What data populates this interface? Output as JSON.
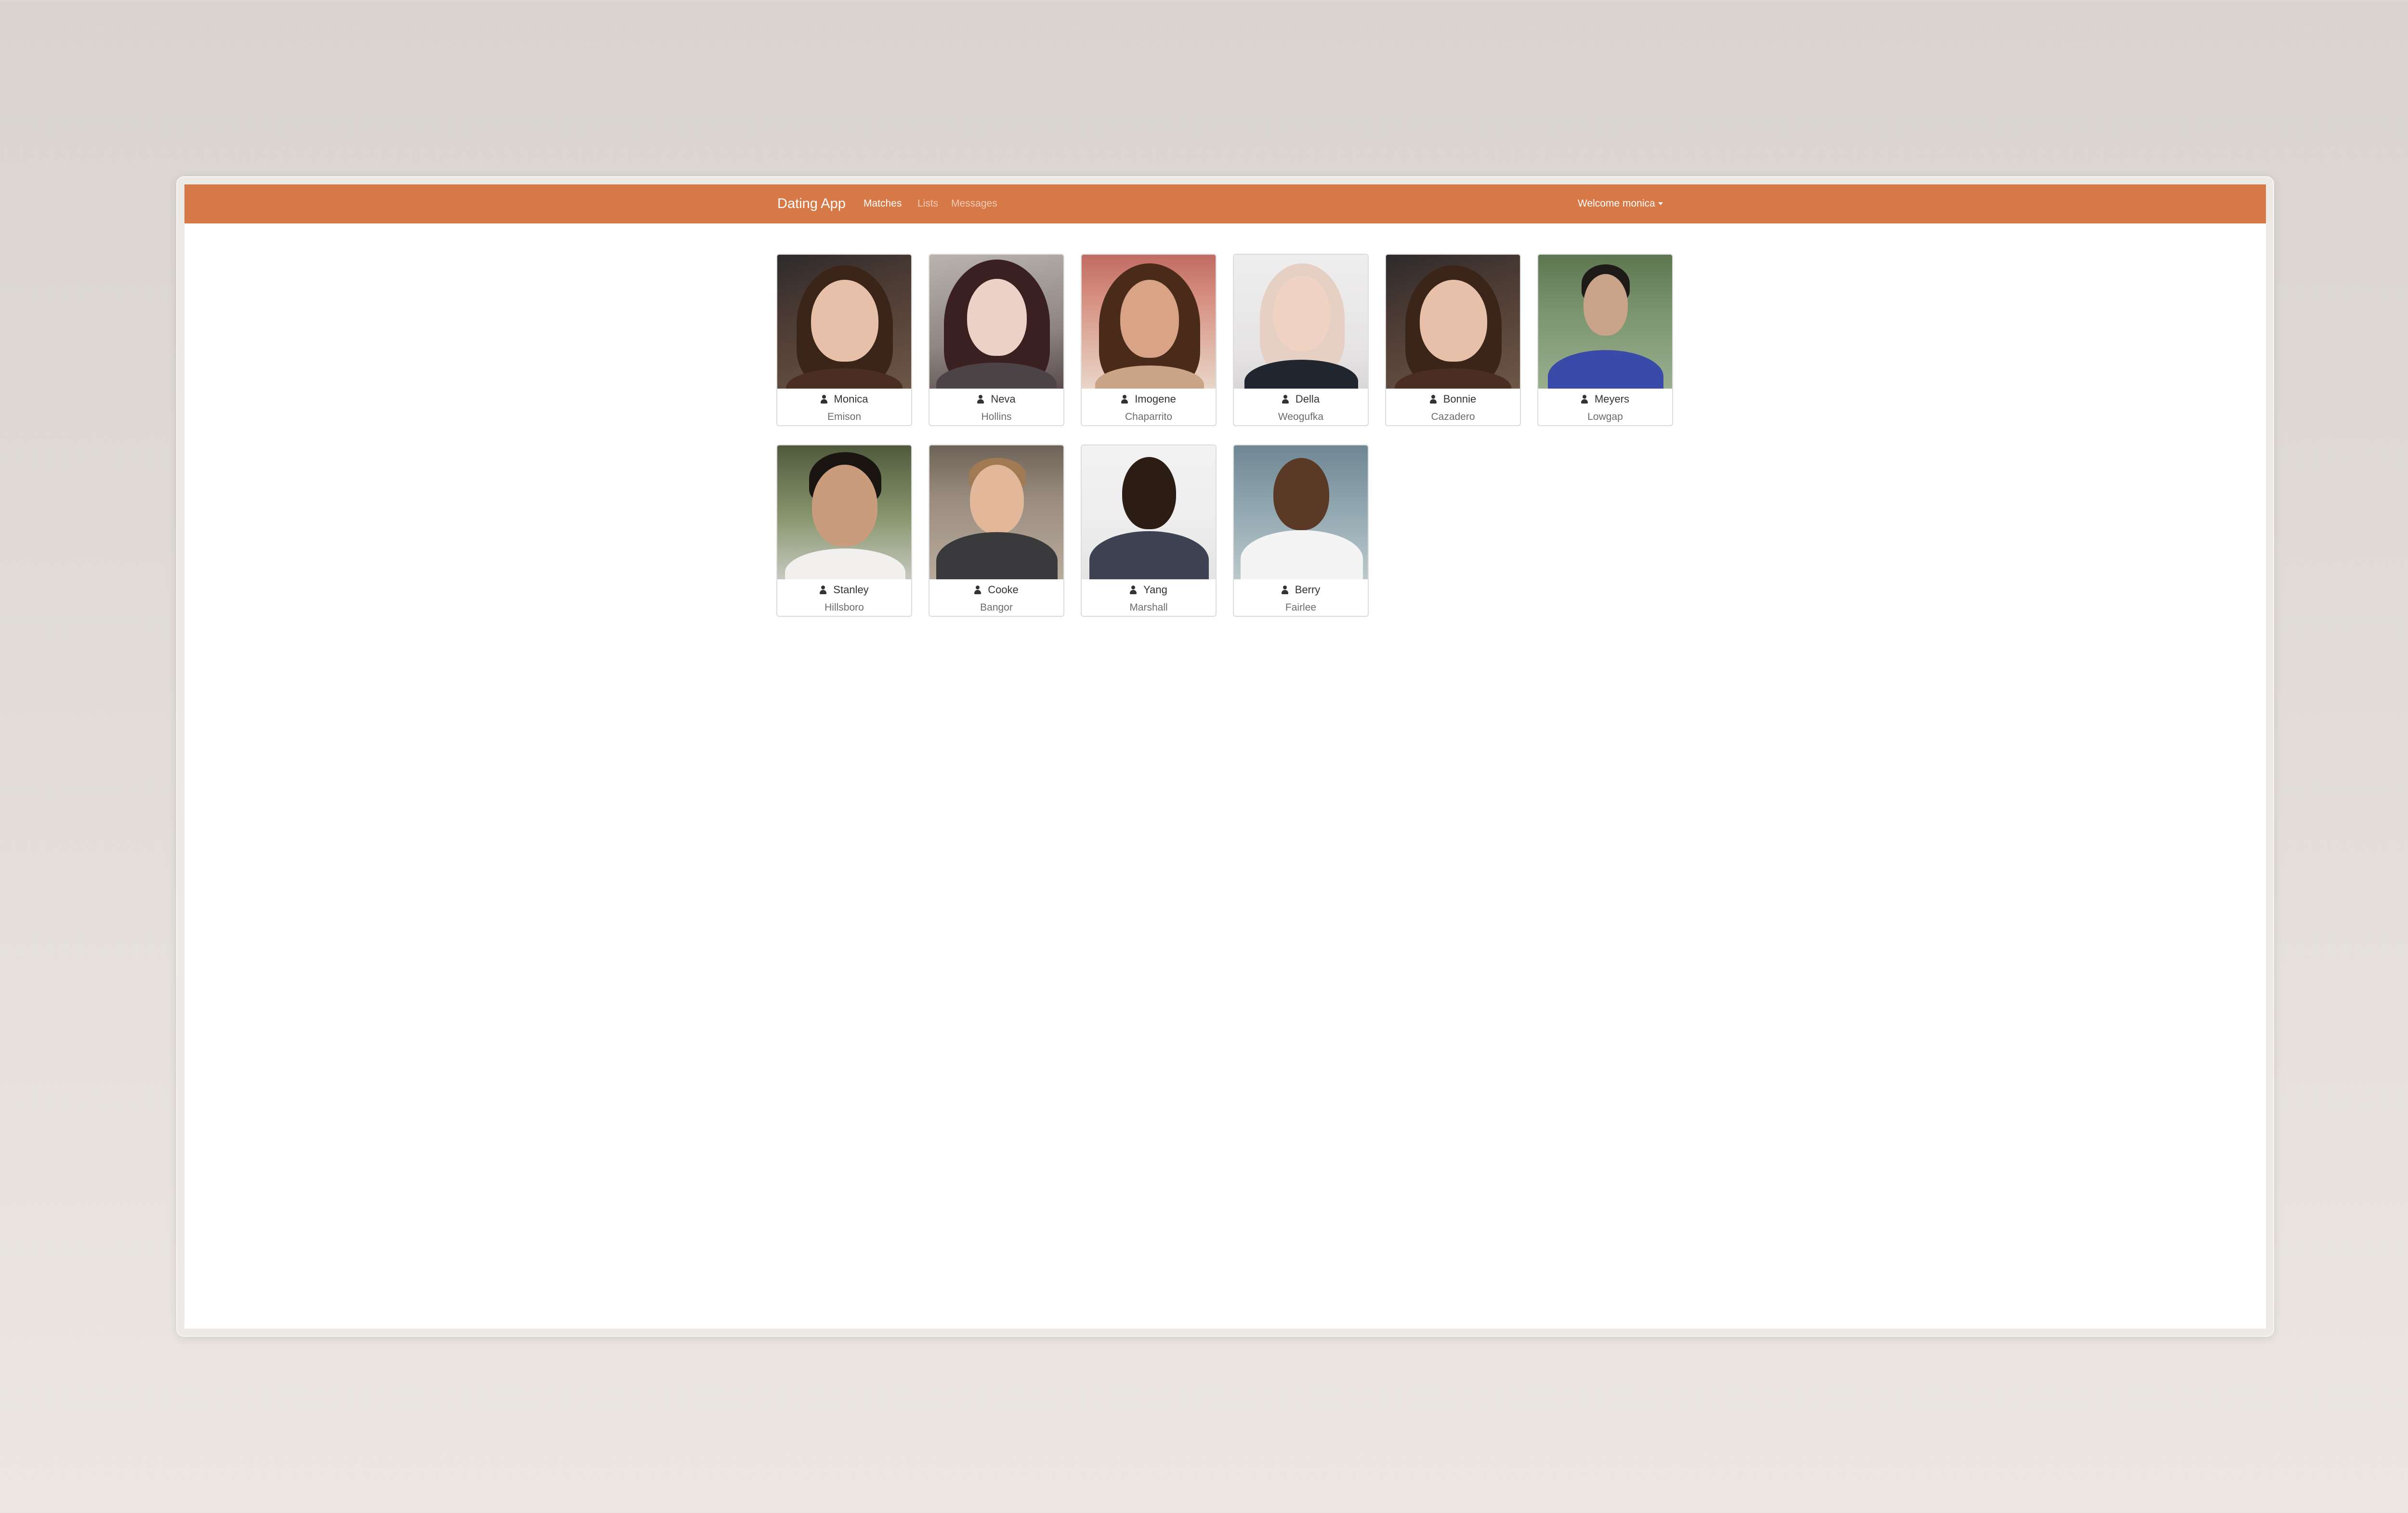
{
  "app": {
    "brand": "Dating App",
    "nav": [
      {
        "label": "Matches",
        "active": true
      },
      {
        "label": "Lists",
        "active": false
      },
      {
        "label": "Messages",
        "active": false
      }
    ],
    "welcome": "Welcome monica",
    "accent_color": "#d77946"
  },
  "members": [
    {
      "name": "Monica",
      "city": "Emison",
      "icon": "user-icon"
    },
    {
      "name": "Neva",
      "city": "Hollins",
      "icon": "user-icon"
    },
    {
      "name": "Imogene",
      "city": "Chaparrito",
      "icon": "user-icon"
    },
    {
      "name": "Della",
      "city": "Weogufka",
      "icon": "user-icon"
    },
    {
      "name": "Bonnie",
      "city": "Cazadero",
      "icon": "user-icon"
    },
    {
      "name": "Meyers",
      "city": "Lowgap",
      "icon": "user-icon"
    },
    {
      "name": "Stanley",
      "city": "Hillsboro",
      "icon": "user-icon"
    },
    {
      "name": "Cooke",
      "city": "Bangor",
      "icon": "user-icon"
    },
    {
      "name": "Yang",
      "city": "Marshall",
      "icon": "user-icon"
    },
    {
      "name": "Berry",
      "city": "Fairlee",
      "icon": "user-icon"
    }
  ]
}
